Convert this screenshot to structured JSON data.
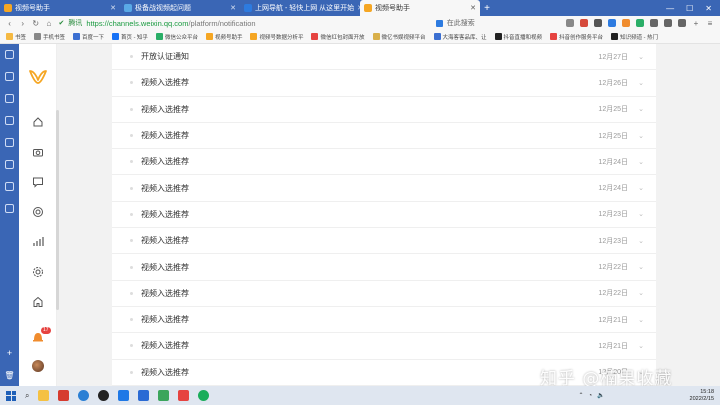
{
  "browser": {
    "tabs": [
      {
        "label": "视频号助手",
        "color": "#f5a623",
        "active": false
      },
      {
        "label": "极备战视频起问题",
        "color": "#5aa9e6",
        "active": false
      },
      {
        "label": "上网导航 - 轻快上网 从这里开始",
        "color": "#2d7be0",
        "active": false
      },
      {
        "label": "视频号助手",
        "color": "#f5a623",
        "active": true
      }
    ],
    "address_label": "腾讯",
    "url_host": "https://channels.weixin.qq.com",
    "url_path": "/platform/notification",
    "search_placeholder": "在此搜索",
    "bookmarks": [
      {
        "label": "书签",
        "color": "#f5b942"
      },
      {
        "label": "手机书签",
        "color": "#888888"
      },
      {
        "label": "百度一下",
        "color": "#3b6fd1"
      },
      {
        "label": "首页 - 知乎",
        "color": "#1772f6"
      },
      {
        "label": "微信公众平台",
        "color": "#2aae67"
      },
      {
        "label": "视频号助手",
        "color": "#f5a623"
      },
      {
        "label": "视频号数据分析平",
        "color": "#f5a623"
      },
      {
        "label": "微信红包封面开放",
        "color": "#e64340"
      },
      {
        "label": "微亿书娱视频平台",
        "color": "#d9b04a"
      },
      {
        "label": "大海客客品库、让",
        "color": "#3b6fd1"
      },
      {
        "label": "抖音直播和视频",
        "color": "#222222"
      },
      {
        "label": "抖音创作服务平台",
        "color": "#e64340"
      },
      {
        "label": "知识频道 - 热门",
        "color": "#222222"
      }
    ]
  },
  "notifications": [
    {
      "title": "开放认证通知",
      "date": "12月27日"
    },
    {
      "title": "视频入选推荐",
      "date": "12月26日"
    },
    {
      "title": "视频入选推荐",
      "date": "12月25日"
    },
    {
      "title": "视频入选推荐",
      "date": "12月25日"
    },
    {
      "title": "视频入选推荐",
      "date": "12月24日"
    },
    {
      "title": "视频入选推荐",
      "date": "12月24日"
    },
    {
      "title": "视频入选推荐",
      "date": "12月23日"
    },
    {
      "title": "视频入选推荐",
      "date": "12月23日"
    },
    {
      "title": "视频入选推荐",
      "date": "12月22日"
    },
    {
      "title": "视频入选推荐",
      "date": "12月22日"
    },
    {
      "title": "视频入选推荐",
      "date": "12月21日"
    },
    {
      "title": "视频入选推荐",
      "date": "12月21日"
    },
    {
      "title": "视频入选推荐",
      "date": "12月20日"
    }
  ],
  "sidebar": {
    "notification_count": "17",
    "icons": [
      "home-icon",
      "camera-icon",
      "comment-icon",
      "target-icon",
      "chart-icon",
      "settings-icon",
      "shop-icon"
    ]
  },
  "watermark": "知乎 @楠果收藏",
  "taskbar": {
    "time": "15:18",
    "date": "2022/2/15"
  },
  "colors": {
    "browser_blue": "#3a66b5",
    "accent_green": "#1a9b40",
    "badge_red": "#e64340"
  }
}
